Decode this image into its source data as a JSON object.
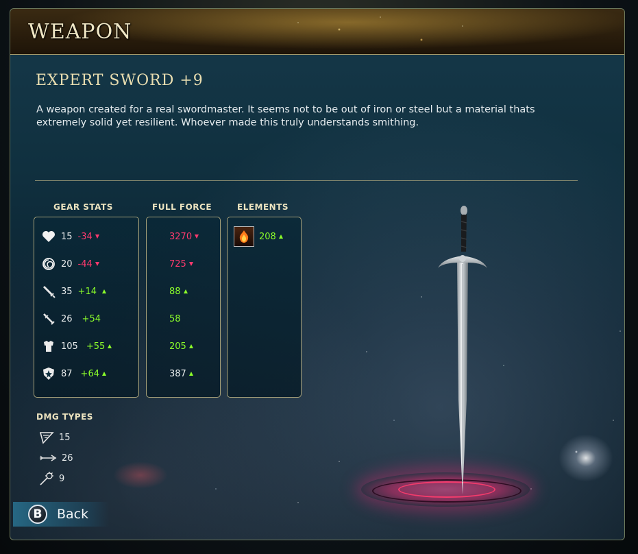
{
  "header": {
    "title": "WEAPON"
  },
  "item": {
    "name": "EXPERT SWORD +9",
    "description": "A weapon created for a real swordmaster. It seems not to be out of iron or steel but a material thats extremely solid yet resilient. Whoever made this truly understands smithing."
  },
  "columns": {
    "gear_stats": "GEAR STATS",
    "full_force": "FULL FORCE",
    "elements": "ELEMENTS"
  },
  "gear_stats": [
    {
      "icon": "heart-icon",
      "base": "15",
      "change": "-34",
      "dir": "down"
    },
    {
      "icon": "spiral-icon",
      "base": "20",
      "change": "-44",
      "dir": "down"
    },
    {
      "icon": "sword-icon",
      "base": "35",
      "change": "+14",
      "dir": "up"
    },
    {
      "icon": "crossed-swords-icon",
      "base": "26",
      "change": "+54",
      "dir": "none"
    },
    {
      "icon": "armor-icon",
      "base": "105",
      "change": "+55",
      "dir": "up"
    },
    {
      "icon": "shield-icon",
      "base": "87",
      "change": "+64",
      "dir": "up"
    }
  ],
  "full_force": [
    {
      "value": "3270",
      "dir": "down",
      "color": "#ff3a6e"
    },
    {
      "value": "725",
      "dir": "down",
      "color": "#ff3a6e"
    },
    {
      "value": "88",
      "dir": "up",
      "color": "#8cff2a"
    },
    {
      "value": "58",
      "dir": "none",
      "color": "#8cff2a"
    },
    {
      "value": "205",
      "dir": "up",
      "color": "#8cff2a"
    },
    {
      "value": "387",
      "dir": "up",
      "color": "#e8ecec"
    }
  ],
  "elements": [
    {
      "icon": "fire-element-icon",
      "value": "208",
      "dir": "up"
    }
  ],
  "dmg_types": {
    "title": "DMG TYPES",
    "items": [
      {
        "icon": "slash-damage-icon",
        "value": "15"
      },
      {
        "icon": "pierce-damage-icon",
        "value": "26"
      },
      {
        "icon": "blunt-damage-icon",
        "value": "9"
      }
    ]
  },
  "back": {
    "button_glyph": "B",
    "label": "Back"
  },
  "colors": {
    "negative": "#ff3a6e",
    "positive": "#8cff2a",
    "gold_text": "#e8ddb0"
  }
}
